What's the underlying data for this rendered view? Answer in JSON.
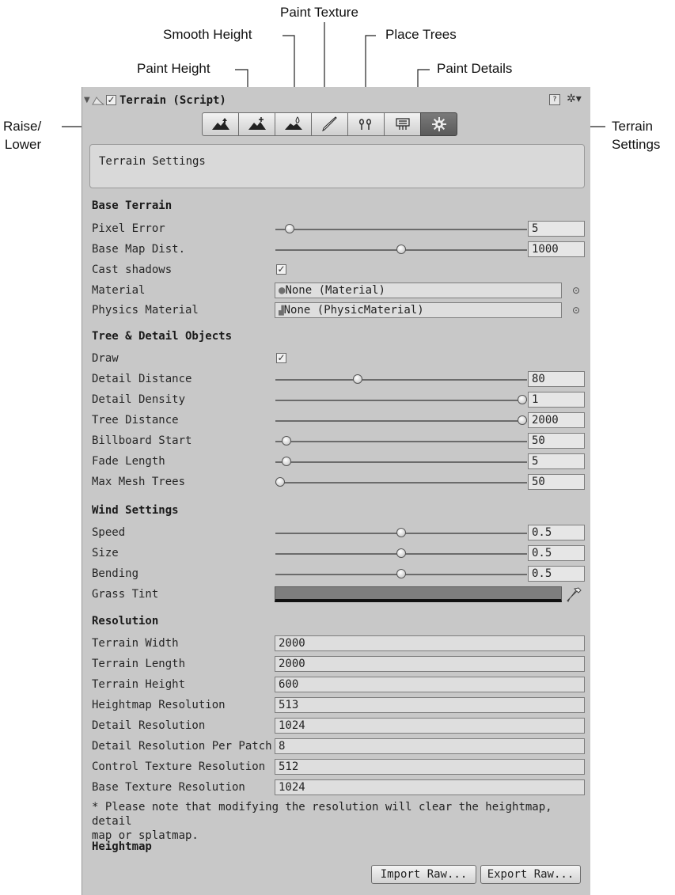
{
  "callouts": {
    "raise_lower": [
      "Raise/",
      "Lower"
    ],
    "paint_height": "Paint Height",
    "smooth_height": "Smooth Height",
    "paint_texture": "Paint Texture",
    "place_trees": "Place Trees",
    "paint_details": "Paint Details",
    "terrain_settings": [
      "Terrain",
      "Settings"
    ]
  },
  "component": {
    "title": "Terrain (Script)",
    "enabled": true,
    "tools": [
      {
        "name": "raise-lower",
        "icon": "raise-lower-icon"
      },
      {
        "name": "paint-height",
        "icon": "paint-height-icon"
      },
      {
        "name": "smooth-height",
        "icon": "smooth-height-icon"
      },
      {
        "name": "paint-texture",
        "icon": "brush-icon"
      },
      {
        "name": "place-trees",
        "icon": "tree-icon"
      },
      {
        "name": "paint-details",
        "icon": "detail-icon"
      },
      {
        "name": "terrain-settings",
        "icon": "gear-icon",
        "active": true
      }
    ]
  },
  "help_box": "Terrain Settings",
  "base_terrain": {
    "heading": "Base Terrain",
    "pixel_error": {
      "label": "Pixel Error",
      "value": "5"
    },
    "base_map_dist": {
      "label": "Base Map Dist.",
      "value": "1000"
    },
    "cast_shadows": {
      "label": "Cast shadows",
      "checked": true
    },
    "material": {
      "label": "Material",
      "value": "None (Material)"
    },
    "physics_material": {
      "label": "Physics Material",
      "value": "None (PhysicMaterial)"
    }
  },
  "tree_detail": {
    "heading": "Tree & Detail Objects",
    "draw": {
      "label": "Draw",
      "checked": true
    },
    "detail_distance": {
      "label": "Detail Distance",
      "value": "80"
    },
    "detail_density": {
      "label": "Detail Density",
      "value": "1"
    },
    "tree_distance": {
      "label": "Tree Distance",
      "value": "2000"
    },
    "billboard_start": {
      "label": "Billboard Start",
      "value": "50"
    },
    "fade_length": {
      "label": "Fade Length",
      "value": "5"
    },
    "max_mesh_trees": {
      "label": "Max Mesh Trees",
      "value": "50"
    }
  },
  "wind": {
    "heading": "Wind Settings",
    "speed": {
      "label": "Speed",
      "value": "0.5"
    },
    "size": {
      "label": "Size",
      "value": "0.5"
    },
    "bending": {
      "label": "Bending",
      "value": "0.5"
    },
    "grass_tint": {
      "label": "Grass Tint",
      "color": "#7e7e7e"
    }
  },
  "resolution": {
    "heading": "Resolution",
    "terrain_width": {
      "label": "Terrain Width",
      "value": "2000"
    },
    "terrain_length": {
      "label": "Terrain Length",
      "value": "2000"
    },
    "terrain_height": {
      "label": "Terrain Height",
      "value": "600"
    },
    "heightmap_resolution": {
      "label": "Heightmap Resolution",
      "value": "513"
    },
    "detail_resolution": {
      "label": "Detail Resolution",
      "value": "1024"
    },
    "detail_resolution_per_patch": {
      "label": "Detail Resolution Per Patch",
      "value": "8"
    },
    "control_texture_resolution": {
      "label": "Control Texture Resolution",
      "value": "512"
    },
    "base_texture_resolution": {
      "label": "Base Texture Resolution",
      "value": "1024"
    },
    "note_line1": "* Please note that modifying the resolution will clear the heightmap, detail",
    "note_line2": "map or splatmap."
  },
  "heightmap": {
    "heading": "Heightmap",
    "import_label": "Import Raw...",
    "export_label": "Export Raw..."
  }
}
